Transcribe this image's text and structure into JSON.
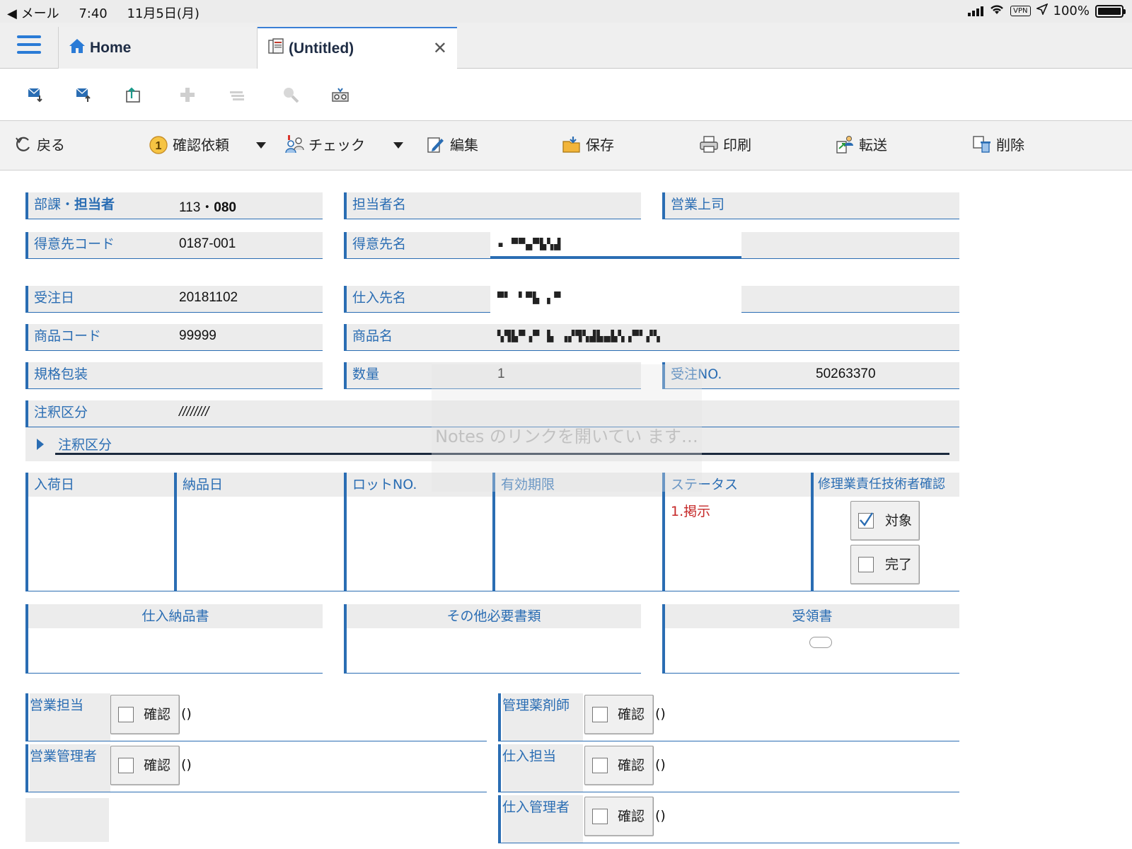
{
  "status_bar": {
    "back_label": "◀ メール",
    "time": "7:40",
    "date": "11月5日(月)",
    "vpn": "VPN",
    "battery": "100%"
  },
  "tabs": [
    {
      "label": "Home",
      "icon": "home-icon"
    },
    {
      "label": "(Untitled)",
      "icon": "document-icon"
    }
  ],
  "icon_toolbar": [
    "mail-down-icon",
    "mail-up-icon",
    "export-icon",
    "add-icon",
    "list-icon",
    "search-icon",
    "binoculars-icon"
  ],
  "actions": {
    "back": "戻る",
    "request": "確認依頼",
    "request_badge": "1",
    "check": "チェック",
    "edit": "編集",
    "save": "保存",
    "print": "印刷",
    "forward": "転送",
    "delete": "削除"
  },
  "fields": {
    "dept_label": "部課・",
    "dept_label_bold": "担当者",
    "dept_value": "113・",
    "dept_value_bold": "080",
    "person_name_label": "担当者名",
    "sales_boss_label": "営業上司",
    "customer_code_label": "得意先コード",
    "customer_code_value": "0187-001",
    "customer_name_label": "得意先名",
    "customer_name_value": "▪ ▀▀▄▀▙▚▟",
    "order_date_label": "受注日",
    "order_date_value": "20181102",
    "supplier_name_label": "仕入先名",
    "supplier_name_value": "▀▘ ▘▀▙ ▖▀",
    "product_code_label": "商品コード",
    "product_code_value": "99999",
    "product_name_label": "商品名",
    "product_name_value": "▚▜▙▀▗▀ ▙ ▗▞▜▚▟▙▄▙▚▗▀▘▞▚",
    "packaging_label": "規格包装",
    "quantity_label": "数量",
    "quantity_value": "1",
    "order_no_label": "受注NO.",
    "order_no_value": "50263370",
    "note_type_label": "注釈区分",
    "note_type_value": "////////",
    "note_section_label": "注釈区分"
  },
  "grid": {
    "arrival_date": "入荷日",
    "delivery_date": "納品日",
    "lot_no": "ロットNO.",
    "expiry": "有効期限",
    "status": "ステータス",
    "status_value": "1.掲示",
    "repair_confirm": "修理業責任技術者確認",
    "target_label": "対象",
    "target_checked": true,
    "done_label": "完了"
  },
  "documents": {
    "supplier_delivery": "仕入納品書",
    "other_docs": "その他必要書類",
    "receipt": "受領書"
  },
  "approvals": {
    "confirm_label": "確認",
    "paren": "()",
    "sales_rep": "営業担当",
    "sales_manager": "営業管理者",
    "pharmacist": "管理薬剤師",
    "purchasing_rep": "仕入担当",
    "purchasing_manager": "仕入管理者"
  },
  "overlay": {
    "loading_text": "Notes のリンクを開いてい ます…"
  },
  "colors": {
    "accent": "#2a6db3",
    "status_red": "#c62828",
    "label_bg": "#ececec"
  }
}
